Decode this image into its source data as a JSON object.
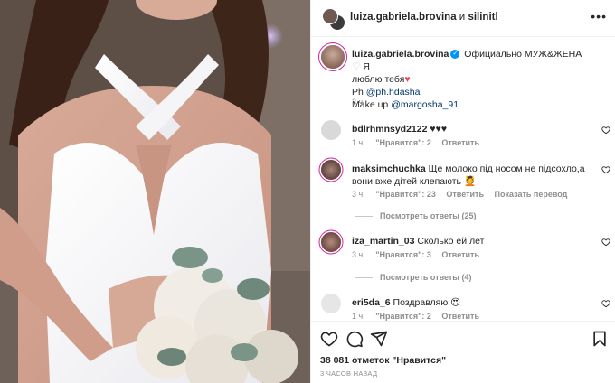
{
  "post": {
    "header": {
      "author": "luiza.gabriela.brovina",
      "joiner": "и",
      "coauthor": "silinitl"
    },
    "caption": {
      "author": "luiza.gabriela.brovina",
      "text_line1": "Официально МУЖ&ЖЕНА",
      "text_line1b": "Я",
      "text_line2": "люблю тебя",
      "ph_label": "Ph",
      "ph_mention": "@ph.hdasha",
      "makeup_label": "Make up",
      "makeup_mention": "@margosha_91",
      "time": "3 ч."
    },
    "comments": [
      {
        "user": "bdlrhmnsyd2122",
        "text": "♥♥♥",
        "time": "1 ч.",
        "likes": "\"Нравится\": 2",
        "reply": "Ответить"
      },
      {
        "user": "maksimchuchka",
        "text": "Ще молоко під носом не підсохло,а вони вже дітей клепають 💆",
        "time": "3 ч.",
        "likes": "\"Нравится\": 23",
        "reply": "Ответить",
        "translate": "Показать перевод",
        "replies": "Посмотреть ответы (25)"
      },
      {
        "user": "iza_martin_03",
        "text": "Сколько ей лет",
        "time": "3 ч.",
        "likes": "\"Нравится\": 3",
        "reply": "Ответить",
        "replies": "Посмотреть ответы (4)"
      },
      {
        "user": "eri5da_6",
        "text": "Поздравляю 😍",
        "time": "1 ч.",
        "likes": "\"Нравится\": 2",
        "reply": "Ответить"
      }
    ],
    "footer": {
      "likes_count": "38 081 отметок \"Нравится\"",
      "posted_ago": "3 ЧАСОВ НАЗАД"
    }
  },
  "colors": {
    "accent": "#0095f6",
    "link": "#00376b",
    "muted": "#8e8e8e",
    "heart": "#ed4956"
  },
  "icons": [
    "more-options-icon",
    "verified-icon",
    "heart-icon",
    "comment-icon",
    "share-icon",
    "bookmark-icon"
  ]
}
